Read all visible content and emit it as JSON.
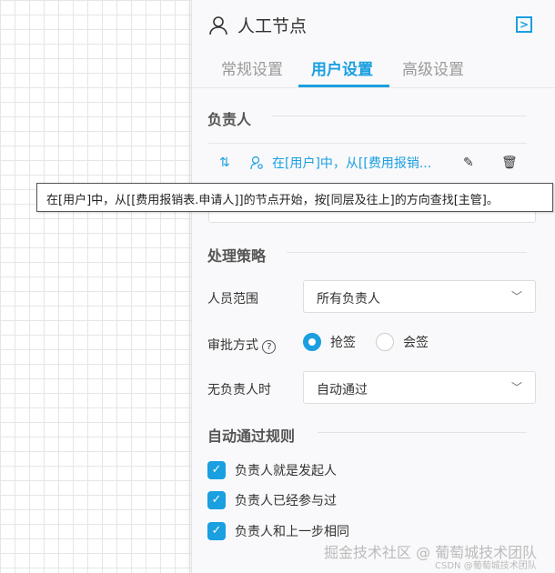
{
  "header": {
    "title": "人工节点",
    "icon": "user-icon",
    "collapse_icon": "collapse-right-icon"
  },
  "tabs": [
    {
      "label": "常规设置"
    },
    {
      "label": "用户设置",
      "active": true
    },
    {
      "label": "高级设置"
    }
  ],
  "assignee": {
    "section": "负责人",
    "item_text": "在[用户]中，从[[费用报销...",
    "tooltip": "在[用户]中，从[[费用报销表.申请人]]的节点开始，按[同层及往上]的方向查找[主管]。"
  },
  "strategy": {
    "section": "处理策略",
    "scope_label": "人员范围",
    "scope_value": "所有负责人",
    "approval_label": "审批方式",
    "approval_options": [
      "抢签",
      "会签"
    ],
    "approval_selected": "抢签",
    "none_label": "无负责人时",
    "none_value": "自动通过"
  },
  "auto": {
    "section": "自动通过规则",
    "rules": [
      {
        "label": "负责人就是发起人",
        "checked": true
      },
      {
        "label": "负责人已经参与过",
        "checked": true
      },
      {
        "label": "负责人和上一步相同",
        "checked": true
      }
    ]
  },
  "watermark": {
    "main": "掘金技术社区 @ 葡萄城技术团队",
    "sub": "CSDN @葡萄城技术团队"
  },
  "colors": {
    "accent": "#1a9fe0"
  }
}
